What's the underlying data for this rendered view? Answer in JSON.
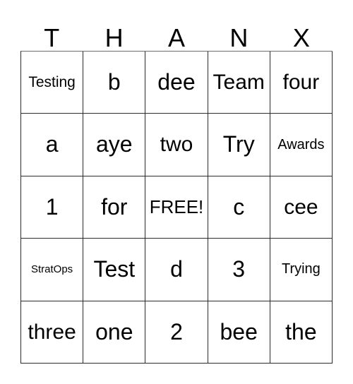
{
  "card": {
    "type": "bingo-card",
    "header_letters": [
      "T",
      "H",
      "A",
      "N",
      "X"
    ],
    "rows": [
      [
        {
          "text": "Testing",
          "size": "smm"
        },
        {
          "text": "b",
          "size": "xl"
        },
        {
          "text": "dee",
          "size": "xl"
        },
        {
          "text": "Team",
          "size": "lg"
        },
        {
          "text": "four",
          "size": "lg"
        }
      ],
      [
        {
          "text": "a",
          "size": "xl"
        },
        {
          "text": "aye",
          "size": "xl"
        },
        {
          "text": "two",
          "size": "lg"
        },
        {
          "text": "Try",
          "size": "xl"
        },
        {
          "text": "Awards",
          "size": "sm"
        }
      ],
      [
        {
          "text": "1",
          "size": "xl"
        },
        {
          "text": "for",
          "size": "xl"
        },
        {
          "text": "FREE!",
          "size": "md"
        },
        {
          "text": "c",
          "size": "xl"
        },
        {
          "text": "cee",
          "size": "lg"
        }
      ],
      [
        {
          "text": "StratOps",
          "size": "xs"
        },
        {
          "text": "Test",
          "size": "xl"
        },
        {
          "text": "d",
          "size": "xl"
        },
        {
          "text": "3",
          "size": "xl"
        },
        {
          "text": "Trying",
          "size": "sm"
        }
      ],
      [
        {
          "text": "three",
          "size": "lg"
        },
        {
          "text": "one",
          "size": "xl"
        },
        {
          "text": "2",
          "size": "xl"
        },
        {
          "text": "bee",
          "size": "xl"
        },
        {
          "text": "the",
          "size": "xl"
        }
      ]
    ],
    "free_space": "FREE!",
    "colors": {
      "background": "#ffffff",
      "text": "#000000",
      "grid_line": "#2b2b2b",
      "grid_line_top": "#6b6b6b"
    }
  }
}
